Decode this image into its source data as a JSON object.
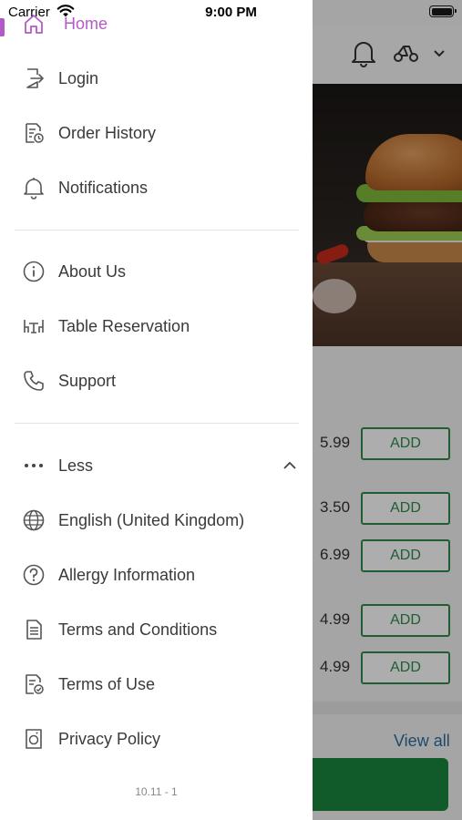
{
  "status_bar": {
    "carrier": "Carrier",
    "time": "9:00 PM",
    "icons": [
      "wifi-icon",
      "battery-icon"
    ]
  },
  "drawer": {
    "partial_top_item": {
      "label": "Home",
      "icon": "home-icon",
      "color": "#b45ac6"
    },
    "section1": [
      {
        "label": "Login",
        "icon": "login-icon"
      },
      {
        "label": "Order History",
        "icon": "order-history-icon"
      },
      {
        "label": "Notifications",
        "icon": "bell-icon"
      }
    ],
    "section2": [
      {
        "label": "About Us",
        "icon": "info-icon"
      },
      {
        "label": "Table Reservation",
        "icon": "table-icon"
      },
      {
        "label": "Support",
        "icon": "phone-icon"
      }
    ],
    "less": {
      "label": "Less",
      "icon": "more-dots-icon",
      "chevron": "chevron-up-icon"
    },
    "section3": [
      {
        "label": "English (United Kingdom)",
        "icon": "globe-icon"
      },
      {
        "label": "Allergy Information",
        "icon": "question-icon"
      },
      {
        "label": "Terms and Conditions",
        "icon": "document-icon"
      },
      {
        "label": "Terms of Use",
        "icon": "document-check-icon"
      },
      {
        "label": "Privacy Policy",
        "icon": "privacy-icon"
      }
    ],
    "version": "10.11 - 1"
  },
  "background": {
    "header_icons": [
      "bell-icon",
      "scooter-icon",
      "chevron-down-icon"
    ],
    "menu_rows": [
      {
        "price": "5.99",
        "button": "ADD"
      },
      {
        "price": "3.50",
        "button": "ADD"
      },
      {
        "price": "6.99",
        "button": "ADD"
      },
      {
        "price": "4.99",
        "button": "ADD"
      },
      {
        "price": "4.99",
        "button": "ADD"
      }
    ],
    "view_all": "View all",
    "colors": {
      "accent_green": "#2e8b4a",
      "cta_green": "#19863d",
      "link_blue": "#2b6f9f"
    }
  }
}
